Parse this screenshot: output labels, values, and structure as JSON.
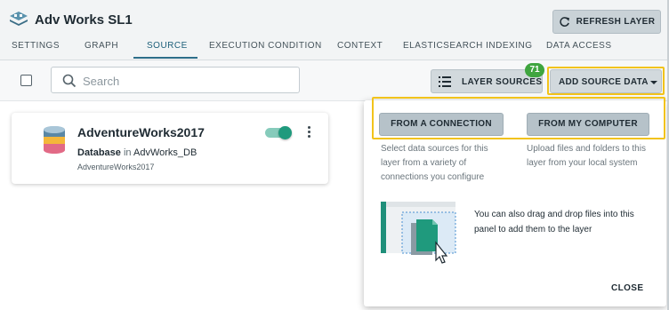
{
  "header": {
    "title": "Adv Works SL1",
    "refresh_label": "REFRESH LAYER"
  },
  "tabs": [
    {
      "label": "SETTINGS"
    },
    {
      "label": "GRAPH"
    },
    {
      "label": "SOURCE",
      "active": true
    },
    {
      "label": "EXECUTION CONDITION"
    },
    {
      "label": "CONTEXT"
    },
    {
      "label": "ELASTICSEARCH INDEXING"
    },
    {
      "label": "DATA ACCESS"
    }
  ],
  "toolbar": {
    "search_placeholder": "Search",
    "search_value": "",
    "layer_sources_label": "LAYER SOURCES",
    "layer_sources_count": "71",
    "add_source_label": "ADD SOURCE DATA"
  },
  "card": {
    "title": "AdventureWorks2017",
    "type": "Database",
    "in_word": "in",
    "location": "AdvWorks_DB",
    "detail": "AdventureWorks2017",
    "enabled": true
  },
  "dropdown": {
    "connection_button": "FROM A CONNECTION",
    "computer_button": "FROM MY COMPUTER",
    "connection_desc": "Select data sources for this layer from a variety of connections you configure",
    "computer_desc": "Upload files and folders to this layer from your local system",
    "drag_text": "You can also drag and drop files into this panel to add them to the layer",
    "close_label": "CLOSE"
  },
  "colors": {
    "accent": "#2d6e8a",
    "toggle_on": "#1f9a7d",
    "badge": "#3fa53f",
    "highlight": "#f2c31b"
  },
  "icons": [
    "layer-stack-icon",
    "refresh-icon",
    "search-icon",
    "list-icon",
    "caret-down-icon",
    "database-icon",
    "more-vertical-icon",
    "drag-drop-illustration"
  ]
}
